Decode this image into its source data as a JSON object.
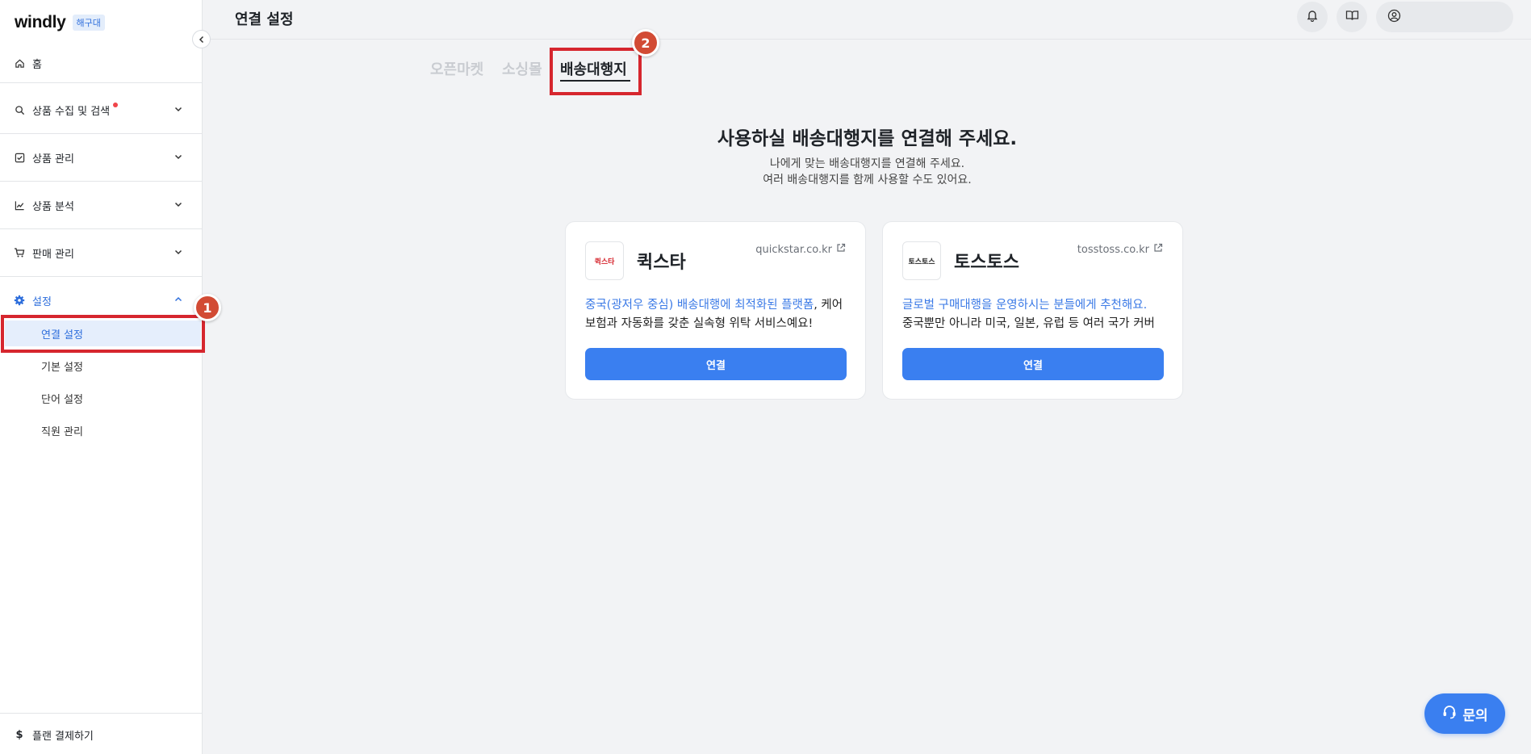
{
  "brand": {
    "logo": "windly",
    "badge": "해구대"
  },
  "sidebar": {
    "items": [
      {
        "label": "홈",
        "icon": "home-icon"
      },
      {
        "label": "상품 수집 및 검색",
        "icon": "search-icon",
        "has_dot": true
      },
      {
        "label": "상품 관리",
        "icon": "checklist-icon"
      },
      {
        "label": "상품 분석",
        "icon": "chart-icon"
      },
      {
        "label": "판매 관리",
        "icon": "cart-icon"
      },
      {
        "label": "설정",
        "icon": "gear-icon",
        "expanded": true
      }
    ],
    "settings_subitems": [
      {
        "label": "연결 설정",
        "active": true
      },
      {
        "label": "기본 설정"
      },
      {
        "label": "단어 설정"
      },
      {
        "label": "직원 관리"
      }
    ],
    "footer": {
      "label": "플랜 결제하기",
      "icon": "dollar-icon"
    }
  },
  "header": {
    "title": "연결 설정"
  },
  "tabs": [
    {
      "label": "오픈마켓"
    },
    {
      "label": "소싱몰"
    },
    {
      "label": "배송대행지",
      "active": true
    }
  ],
  "main": {
    "heading": "사용하실 배송대행지를 연결해 주세요.",
    "sub1": "나에게 맞는 배송대행지를 연결해 주세요.",
    "sub2": "여러 배송대행지를 함께 사용할 수도 있어요."
  },
  "cards": [
    {
      "name": "퀵스타",
      "logo_text": "퀵스타",
      "url": "quickstar.co.kr",
      "desc_highlight": "중국(광저우 중심) 배송대행에 최적화된 플랫폼",
      "desc_rest": ", 케어보험과 자동화를 갖춘 실속형 위탁 서비스예요!",
      "button": "연결"
    },
    {
      "name": "토스토스",
      "logo_text": "토스토스",
      "url": "tosstoss.co.kr",
      "desc_highlight": "글로벌 구매대행을 운영하시는 분들에게 추천해요.",
      "desc_rest": "중국뿐만 아니라 미국, 일본, 유럽 등 여러 국가 커버",
      "button": "연결"
    }
  ],
  "annotations": {
    "step1": "1",
    "step2": "2"
  },
  "inquiry": {
    "label": "문의"
  },
  "colors": {
    "accent": "#3a7ff0",
    "annotation_red": "#d6262e",
    "badge_orange": "#d24b34"
  }
}
